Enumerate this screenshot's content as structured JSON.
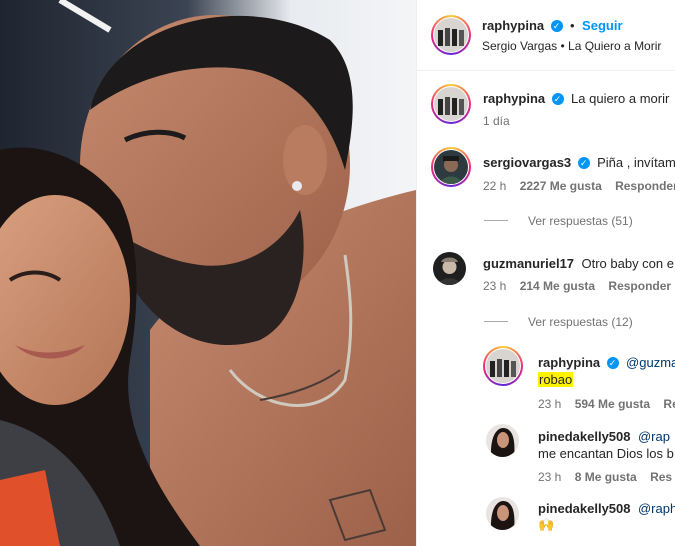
{
  "post": {
    "author": "raphypina",
    "follow_label": "Seguir",
    "separator": "•",
    "audio": "Sergio Vargas • La Quiero a Morir"
  },
  "caption": {
    "user": "raphypina",
    "text": "La quiero a morir",
    "time": "1 día"
  },
  "comments": [
    {
      "user": "sergiovargas3",
      "text": "Piña , invítame",
      "time": "22 h",
      "likes": "2227 Me gusta",
      "reply_label": "Responder",
      "view_replies": "Ver respuestas (51)"
    },
    {
      "user": "guzmanuriel17",
      "text": "Otro baby con e",
      "time": "23 h",
      "likes": "214 Me gusta",
      "reply_label": "Responder",
      "view_replies": "Ver respuestas (12)"
    }
  ],
  "replies": [
    {
      "user": "raphypina",
      "mention": "@guzma",
      "text2": "robao",
      "time": "23 h",
      "likes": "594 Me gusta",
      "reply_label": "Res"
    },
    {
      "user": "pinedakelly508",
      "mention": "@rap",
      "text2": "me encantan Dios los b",
      "time": "23 h",
      "likes": "8 Me gusta",
      "reply_label": "Res"
    },
    {
      "user": "pinedakelly508",
      "mention": "@raph",
      "text2": "🙌"
    }
  ],
  "colors": {
    "accent": "#0095f6",
    "highlight": "#fff200",
    "text": "#262626",
    "muted": "#737373"
  }
}
